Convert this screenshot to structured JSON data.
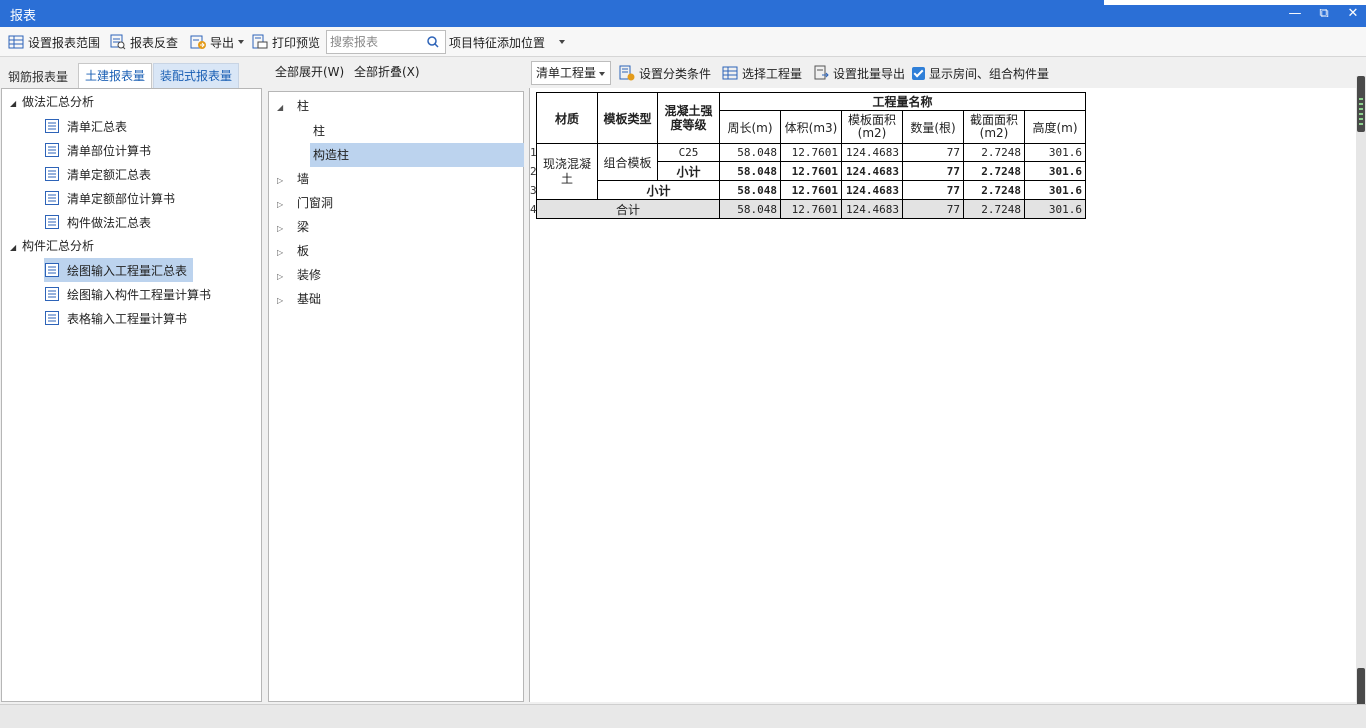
{
  "window": {
    "title": "报表"
  },
  "toolbar": {
    "set_range": "设置报表范围",
    "reverse_check": "报表反查",
    "export": "导出",
    "print_preview": "打印预览",
    "search_placeholder": "搜索报表",
    "item_feature_pos": "项目特征添加位置"
  },
  "left": {
    "tabs": [
      "钢筋报表量",
      "土建报表量",
      "装配式报表量"
    ],
    "groups": [
      {
        "label": "做法汇总分析",
        "items": [
          "清单汇总表",
          "清单部位计算书",
          "清单定额汇总表",
          "清单定额部位计算书",
          "构件做法汇总表"
        ]
      },
      {
        "label": "构件汇总分析",
        "items": [
          "绘图输入工程量汇总表",
          "绘图输入构件工程量计算书",
          "表格输入工程量计算书"
        ]
      }
    ],
    "selected": "绘图输入工程量汇总表"
  },
  "middle": {
    "expand_all": "全部展开(W)",
    "collapse_all": "全部折叠(X)",
    "tree": {
      "zhu": "柱",
      "zhu_child_1": "柱",
      "zhu_child_2": "构造柱",
      "others": [
        "墙",
        "门窗洞",
        "梁",
        "板",
        "装修",
        "基础"
      ]
    }
  },
  "right": {
    "select_value": "清单工程量",
    "set_category": "设置分类条件",
    "select_quantity": "选择工程量",
    "batch_export": "设置批量导出",
    "show_room": "显示房间、组合构件量",
    "show_room_checked": true,
    "table": {
      "header_group": "工程量名称",
      "col_material": "材质",
      "col_formwork": "模板类型",
      "col_grade": "混凝土强度等级",
      "cols": [
        "周长(m)",
        "体积(m3)",
        "模板面积(m2)",
        "数量(根)",
        "截面面积(m2)",
        "高度(m)"
      ],
      "row_numbers": [
        "1",
        "2",
        "3",
        "4"
      ],
      "material": "现浇混凝土",
      "formwork": "组合模板",
      "grade": "C25",
      "subtotal_label": "小计",
      "total_label": "合计",
      "row_c25": [
        "58.048",
        "12.7601",
        "124.4683",
        "77",
        "2.7248",
        "301.6"
      ],
      "row_subtotal1": [
        "58.048",
        "12.7601",
        "124.4683",
        "77",
        "2.7248",
        "301.6"
      ],
      "row_subtotal2": [
        "58.048",
        "12.7601",
        "124.4683",
        "77",
        "2.7248",
        "301.6"
      ],
      "row_total": [
        "58.048",
        "12.7601",
        "124.4683",
        "77",
        "2.7248",
        "301.6"
      ]
    }
  },
  "colors": {
    "titlebar": "#2b6fd6",
    "selection": "#bcd3ee",
    "icon_blue": "#2d63b8"
  },
  "icons": [
    "table-range-icon",
    "report-reverse-icon",
    "export-icon",
    "print-preview-icon",
    "search-icon",
    "report-doc-icon",
    "category-icon",
    "select-quantity-icon",
    "batch-export-icon",
    "checkbox-icon"
  ]
}
